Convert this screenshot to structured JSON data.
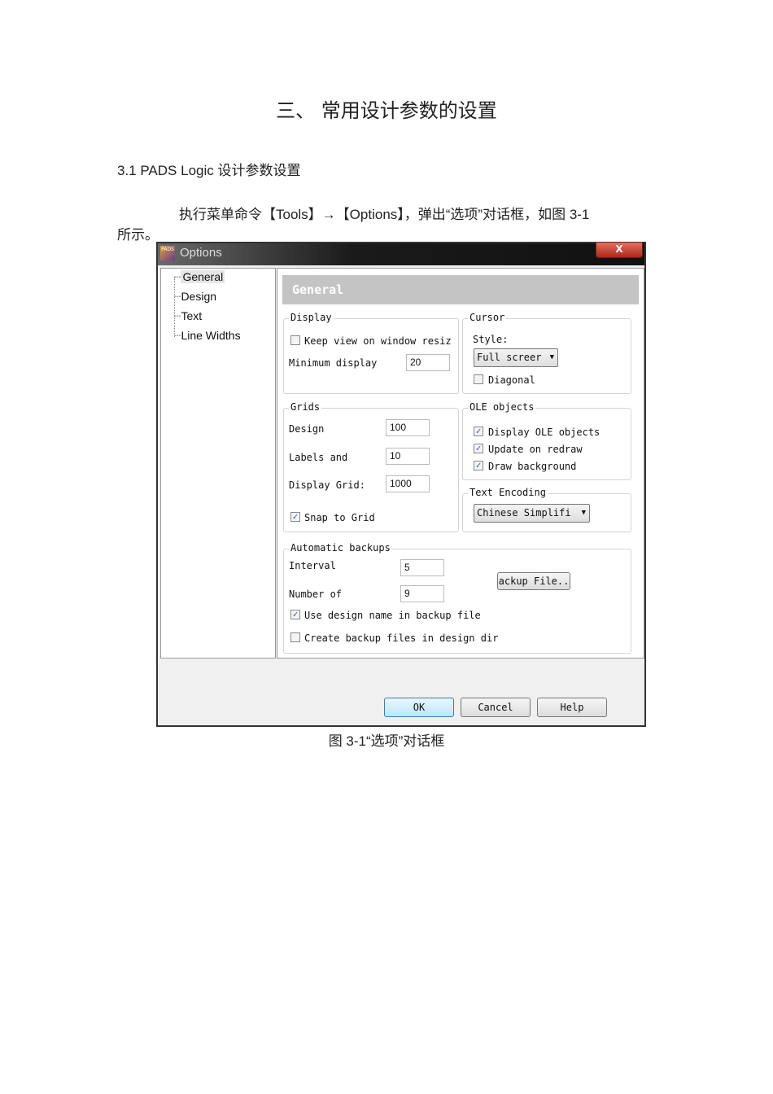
{
  "doc": {
    "heading": "三、  常用设计参数的设置",
    "subheading": "3.1 PADS Logic  设计参数设置",
    "para_line1": "执行菜单命令【Tools】→【Options】，弹出“选项”对话框，如图 3-1",
    "para_line2": "所示。",
    "caption": "图 3-1“选项”对话框"
  },
  "dialog": {
    "title": "Options",
    "app_icon_text": "PADS",
    "close_label": "X",
    "tree": [
      "General",
      "Design",
      "Text",
      "Line Widths"
    ],
    "panel_header": "General",
    "display": {
      "legend": "Display",
      "keep_view": "Keep view on window resiz",
      "keep_view_checked": false,
      "min_display_label": "Minimum display",
      "min_display_value": "20"
    },
    "cursor": {
      "legend": "Cursor",
      "style_label": "Style:",
      "style_value": "Full screer",
      "diagonal": "Diagonal",
      "diagonal_checked": false
    },
    "grids": {
      "legend": "Grids",
      "design_label": "Design",
      "design_value": "100",
      "labels_label": "Labels and",
      "labels_value": "10",
      "display_grid_label": "Display Grid:",
      "display_grid_value": "1000",
      "snap": "Snap to Grid",
      "snap_checked": true
    },
    "ole": {
      "legend": "OLE objects",
      "display": "Display OLE objects",
      "update": "Update on redraw",
      "draw_bg": "Draw background"
    },
    "encoding": {
      "legend": "Text Encoding",
      "value": "Chinese Simplifi"
    },
    "backups": {
      "legend": "Automatic backups",
      "interval_label": "Interval",
      "interval_value": "5",
      "number_label": "Number of",
      "number_value": "9",
      "backup_file_button": "ackup File..",
      "use_name": "Use design name in backup file",
      "use_name_checked": true,
      "create_in_dir": "Create backup files in design dir",
      "create_in_dir_checked": false
    },
    "buttons": {
      "ok": "OK",
      "cancel": "Cancel",
      "help": "Help"
    }
  }
}
